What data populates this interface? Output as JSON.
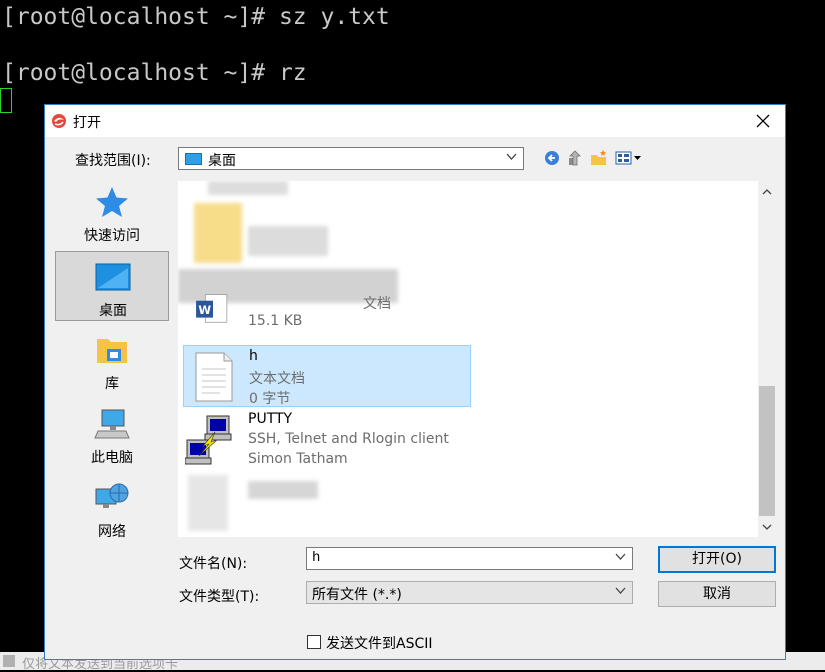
{
  "terminal": {
    "lines": [
      "[root@localhost ~]# sz y.txt",
      "[root@localhost ~]# rz"
    ],
    "status_text": "仅将文本发送到当前选项卡"
  },
  "dialog": {
    "title": "打开",
    "look_in_label": "查找范围(I):",
    "look_in_value": "桌面",
    "places": [
      {
        "label": "快速访问"
      },
      {
        "label": "桌面"
      },
      {
        "label": "库"
      },
      {
        "label": "此电脑"
      },
      {
        "label": "网络"
      }
    ],
    "files": [
      {
        "name": "",
        "line2": "文档",
        "line3": "15.1 KB"
      },
      {
        "name": "h",
        "line2": "文本文档",
        "line3": "0 字节"
      },
      {
        "name": "PUTTY",
        "line2": "SSH, Telnet and Rlogin client",
        "line3": "Simon Tatham"
      }
    ],
    "filename_label": "文件名(N):",
    "filename_value": "h",
    "filetype_label": "文件类型(T):",
    "filetype_value": "所有文件 (*.*)",
    "open_button": "打开(O)",
    "cancel_button": "取消",
    "ascii_label": "发送文件到ASCII",
    "icons": {
      "title": "app-swirl-icon",
      "back": "back-arrow-icon",
      "up": "up-folder-icon",
      "new_folder": "new-folder-icon",
      "view": "view-menu-icon"
    }
  }
}
